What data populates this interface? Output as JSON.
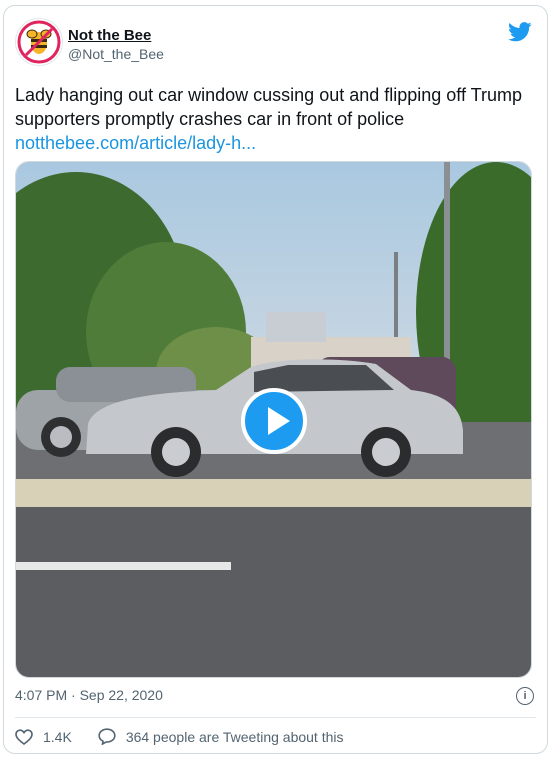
{
  "author": {
    "name": "Not the Bee",
    "handle": "@Not_the_Bee",
    "avatar_icon": "bee-logo-icon"
  },
  "tweet": {
    "text": "Lady hanging out car window cussing out and flipping off Trump supporters promptly crashes car in front of police",
    "link": "notthebee.com/article/lady-h..."
  },
  "media": {
    "type": "video",
    "play_icon": "play-icon"
  },
  "meta": {
    "timestamp": "4:07 PM · Sep 22, 2020",
    "info_icon": "info-icon"
  },
  "actions": {
    "likes": "1.4K",
    "tweeting": "364 people are Tweeting about this"
  },
  "colors": {
    "accent": "#1d9bf0",
    "link": "#1b95e0"
  }
}
